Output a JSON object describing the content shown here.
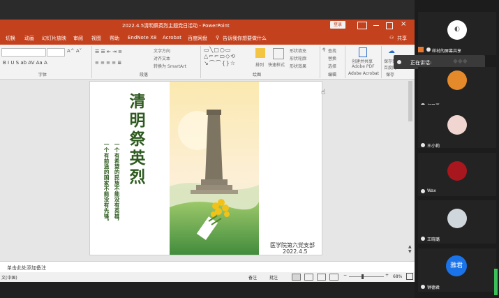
{
  "window": {
    "title": "2022.4.5清明祭英烈主题党日活动 - PowerPoint",
    "login_label": "登录"
  },
  "tabs": [
    "切换",
    "动画",
    "幻灯片放映",
    "审阅",
    "视图",
    "帮助",
    "EndNote X8",
    "Acrobat",
    "百度网盘",
    "告诉我你想要做什么"
  ],
  "share_label": "共享",
  "ribbon": {
    "groups": [
      "字体",
      "段落",
      "绘图",
      "编辑",
      "Adobe Acrobat",
      "保存"
    ],
    "text_direction": "文字方向",
    "align_text": "对齐文本",
    "smartart": "转换为 SmartArt",
    "arrange": "排列",
    "quick_styles": "快速样式",
    "shape_fill": "形状填充",
    "shape_outline": "形状轮廓",
    "shape_effects": "形状效果",
    "find": "查找",
    "replace": "替换",
    "select": "选择",
    "create_share": "创建并共享",
    "adobe_pdf": "Adobe PDF",
    "save_to": "保存到",
    "baidu": "百度网"
  },
  "slide": {
    "title_chars": [
      "清",
      "明",
      "祭",
      "英",
      "烈"
    ],
    "poem_col1": "一个有希望的民族不能没有英雄，",
    "poem_col2": "一个有前途的国家不能没有先锋。",
    "org": "医学院第六党支部",
    "date": "2022.4.5"
  },
  "notes_placeholder": "单击此处添加备注",
  "status": {
    "lang": "文(中国)",
    "notes": "备注",
    "comments": "批注",
    "zoom": "68%"
  },
  "participants": {
    "sharing_label": "样衬的屏幕共享",
    "speaking_label": "正在讲话:",
    "names": [
      "何思晋",
      "王小莉",
      "Wax",
      "王晓璐",
      "钟德君"
    ],
    "initials_last": "雅君"
  },
  "colors": {
    "ppt_red": "#c4411e",
    "title_green": "#2d5a1e",
    "accent_blue": "#1a73e8"
  }
}
